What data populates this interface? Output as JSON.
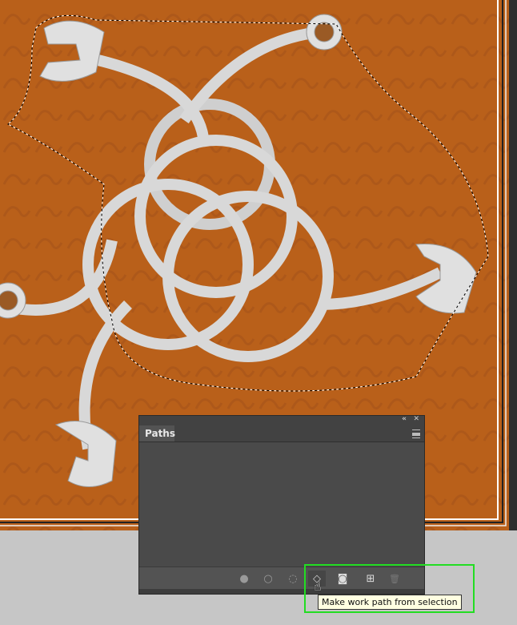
{
  "canvas": {
    "background_color": "#b9601a",
    "marching_ants": true
  },
  "panel": {
    "collapse_icon": "«",
    "close_icon": "✕",
    "tab_label": "Paths",
    "menu_icon": "panel-menu-icon",
    "toolbar": [
      {
        "name": "fill-path-button",
        "icon": "●"
      },
      {
        "name": "stroke-path-button",
        "icon": "○"
      },
      {
        "name": "load-path-as-selection-button",
        "icon": "◌"
      },
      {
        "name": "make-work-path-button",
        "icon": "◇"
      },
      {
        "name": "add-mask-button",
        "icon": "◙"
      },
      {
        "name": "new-path-button",
        "icon": "⊞"
      },
      {
        "name": "delete-path-button",
        "icon": "🗑"
      }
    ]
  },
  "tooltip": {
    "text": "Make work path from selection"
  },
  "highlight_color": "#22dd22"
}
